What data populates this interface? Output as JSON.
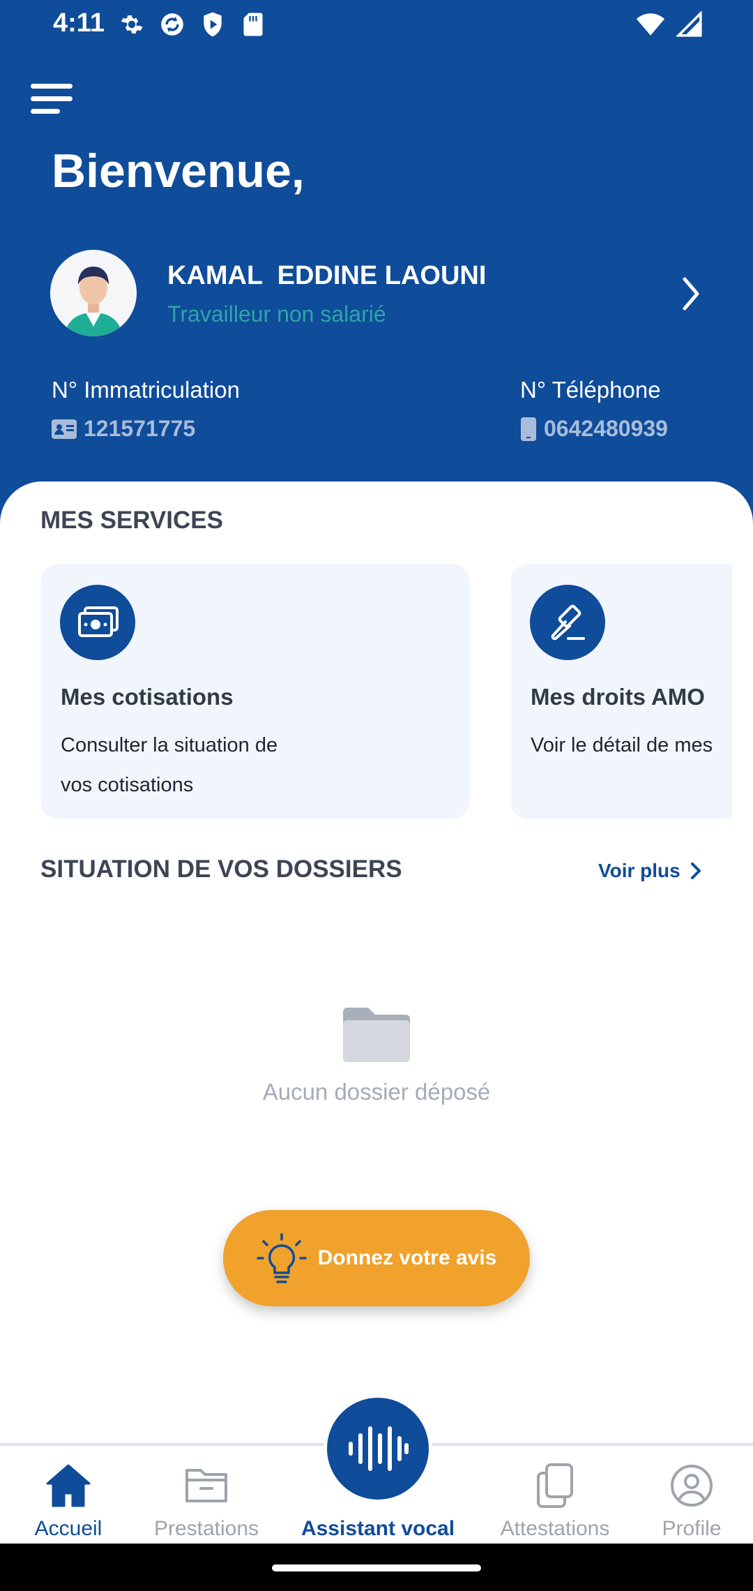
{
  "status_bar": {
    "time": "4:11",
    "left_icons": [
      "settings-icon",
      "sync-icon",
      "shield-play-icon",
      "sd-card-icon"
    ],
    "right_icons": [
      "wifi-icon",
      "signal-icon"
    ]
  },
  "header": {
    "menu_icon": "hamburger-menu-icon",
    "welcome": "Bienvenue,",
    "user": {
      "name": "KAMAL  EDDINE LAOUNI",
      "status": "Travailleur non salarié"
    },
    "immatriculation": {
      "label": "N° Immatriculation",
      "value": "121571775",
      "icon": "id-card-icon"
    },
    "telephone": {
      "label": "N° Téléphone",
      "value": "0642480939",
      "icon": "phone-icon"
    }
  },
  "services": {
    "title": "MES SERVICES",
    "cards": [
      {
        "icon": "money-icon",
        "title": "Mes cotisations",
        "description_line1": "Consulter la situation de",
        "description_line2": "vos cotisations"
      },
      {
        "icon": "gavel-icon",
        "title": "Mes droits AMO",
        "description_line1": "Voir le détail de mes"
      }
    ]
  },
  "dossiers": {
    "title": "SITUATION DE VOS DOSSIERS",
    "see_more": "Voir plus",
    "empty_text": "Aucun dossier déposé"
  },
  "feedback": {
    "label": "Donnez votre avis",
    "icon": "lightbulb-icon"
  },
  "bottom_nav": {
    "items": [
      {
        "label": "Accueil",
        "icon": "home-icon",
        "active": true
      },
      {
        "label": "Prestations",
        "icon": "folder-icon",
        "active": false
      },
      {
        "label": "Attestations",
        "icon": "documents-icon",
        "active": false
      },
      {
        "label": "Profile",
        "icon": "user-circle-icon",
        "active": false
      }
    ],
    "voice": {
      "label": "Assistant vocal",
      "icon": "soundwave-icon"
    }
  },
  "colors": {
    "primary": "#0f4c9a",
    "accent": "#f0a22c",
    "teal": "#2ea5a8",
    "card_bg": "#f1f6fd"
  }
}
